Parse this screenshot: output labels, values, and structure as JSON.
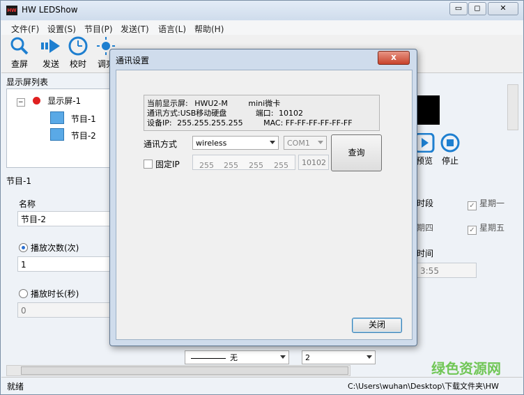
{
  "app": {
    "title": "HW LEDShow",
    "logo_text": "HW"
  },
  "window_controls": {
    "minimize": "▭",
    "maximize": "◻",
    "close": "✕"
  },
  "menu": [
    "文件(F)",
    "设置(S)",
    "节目(P)",
    "发送(T)",
    "语言(L)",
    "帮助(H)"
  ],
  "toolbar": {
    "find": "查屏",
    "send": "发送",
    "clock": "校时",
    "adjust": "调亮",
    "play": "预览",
    "stop": "停止"
  },
  "screen_list": {
    "header": "显示屏列表",
    "screen": "显示屏-1",
    "programs": [
      "节目-1",
      "节目-2"
    ]
  },
  "program_panel": {
    "header": "节目-1",
    "name_label": "名称",
    "name_value": "节目-2",
    "play_count_label": "播放次数(次)",
    "play_count_value": "1",
    "play_duration_label": "播放时长(秒)",
    "play_duration_value": "0",
    "line_style": "无",
    "line_width": "2",
    "time_segment_label": "时段",
    "weekday_1": "星期一",
    "weekday_4": "期四",
    "weekday_5": "星期五",
    "time_label": "时间",
    "time_value": "3:55"
  },
  "status": {
    "left": "就绪",
    "right": "C:\\Users\\wuhan\\Desktop\\下载文件夹\\HW"
  },
  "dialog": {
    "title": "通讯设置",
    "close_icon": "x",
    "info": {
      "current_screen_label": "当前显示屏:",
      "current_screen_value": "HWU2-M",
      "card_type": "mini微卡",
      "comm_mode_label": "通讯方式:",
      "comm_mode_value": "USB移动硬盘",
      "port_label": "端口:",
      "port_value": "10102",
      "ip_label": "设备IP:",
      "ip_value": "255.255.255.255",
      "mac_label": "MAC:",
      "mac_value": "FF-FF-FF-FF-FF-FF"
    },
    "comm_label": "通讯方式",
    "comm_select": "wireless",
    "com_port": "COM1",
    "query_button": "查询",
    "fixed_ip_label": "固定IP",
    "ip_segments": [
      "255",
      "255",
      "255",
      "255"
    ],
    "port_field": "10102",
    "close_button": "关闭"
  },
  "watermark": {
    "text": "绿色资源网"
  }
}
